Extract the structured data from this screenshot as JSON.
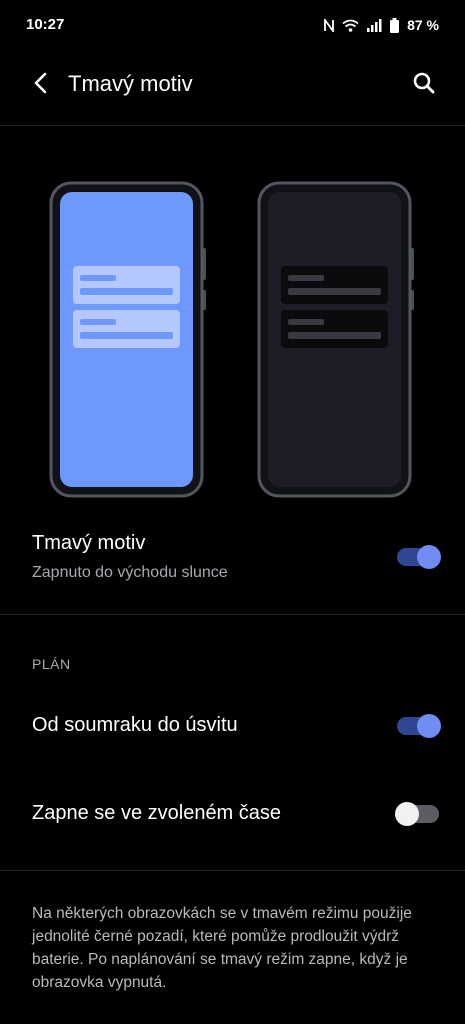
{
  "status_bar": {
    "time": "10:27",
    "battery_percent": "87 %",
    "icons": [
      "nfc-icon",
      "wifi-icon",
      "signal-icon",
      "battery-icon"
    ]
  },
  "app_bar": {
    "title": "Tmavý motiv",
    "back_icon": "back-arrow-icon",
    "search_icon": "search-icon"
  },
  "preview": {
    "light_screen_color": "#6f98ff",
    "dark_screen_color": "#1c1d27"
  },
  "dark_theme": {
    "title": "Tmavý motiv",
    "subtitle": "Zapnuto do východu slunce",
    "enabled": true
  },
  "schedule": {
    "section_label": "PLÁN",
    "options": [
      {
        "label": "Od soumraku do úsvitu",
        "enabled": true
      },
      {
        "label": "Zapne se ve zvoleném čase",
        "enabled": false
      }
    ]
  },
  "footer": {
    "note": "Na některých obrazovkách se v tmavém režimu použije jednolité černé pozadí, které pomůže prodloužit výdrž baterie. Po naplánování se tmavý režim zapne, když je obrazovka vypnutá."
  },
  "colors": {
    "accent": "#6f8df2",
    "accent_track": "#304692",
    "background": "#000000"
  }
}
